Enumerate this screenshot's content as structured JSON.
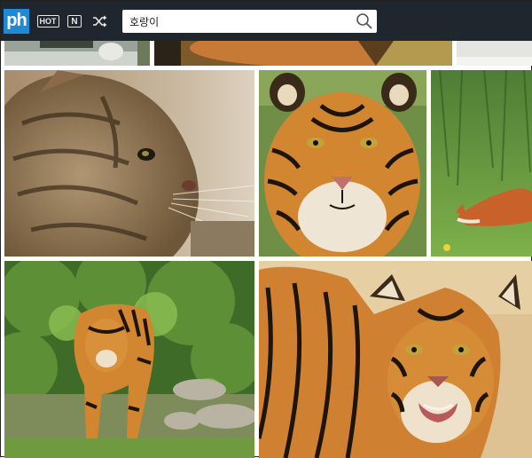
{
  "header": {
    "logo_text": "ph",
    "hot_label": "HOT",
    "new_label": "N",
    "search": {
      "value": "호랑이",
      "placeholder": ""
    }
  },
  "icons": {
    "hot": "hot-icon",
    "new": "new-icon",
    "random": "shuffle-icon",
    "search": "search-icon"
  },
  "colors": {
    "topbar": "#20262e",
    "logo": "#1e8ad6"
  },
  "results": [
    {
      "name": "cat-closeup-photo"
    },
    {
      "name": "tiger-face-photo"
    },
    {
      "name": "fox-in-grass-photo"
    },
    {
      "name": "tiger-walking-photo"
    },
    {
      "name": "tiger-portrait-photo"
    }
  ]
}
